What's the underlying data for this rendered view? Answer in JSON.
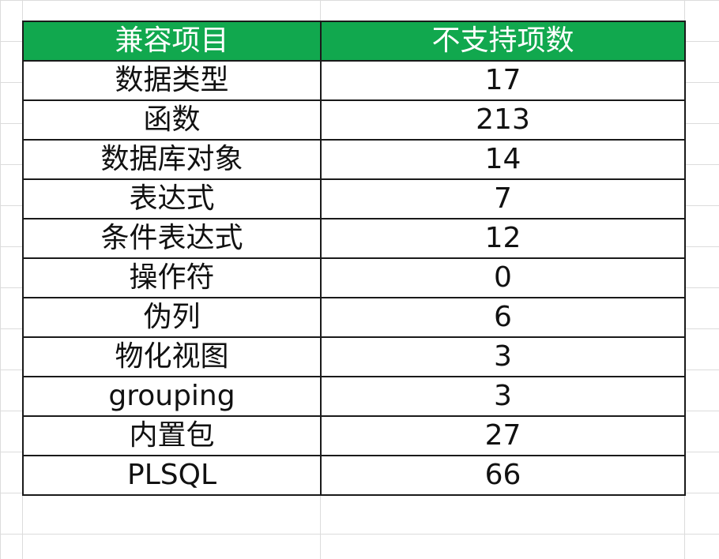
{
  "sheet": {
    "header": {
      "col1": "兼容项目",
      "col2": "不支持项数"
    },
    "rows": [
      {
        "item": "数据类型",
        "count": "17"
      },
      {
        "item": "函数",
        "count": "213"
      },
      {
        "item": "数据库对象",
        "count": "14"
      },
      {
        "item": "表达式",
        "count": "7"
      },
      {
        "item": "条件表达式",
        "count": "12"
      },
      {
        "item": "操作符",
        "count": "0"
      },
      {
        "item": "伪列",
        "count": "6"
      },
      {
        "item": "物化视图",
        "count": "3"
      },
      {
        "item": "grouping",
        "count": "3"
      },
      {
        "item": "内置包",
        "count": "27"
      },
      {
        "item": "PLSQL",
        "count": "66"
      }
    ]
  },
  "colors": {
    "header_bg": "#11a84e",
    "header_text": "#ffffff",
    "border": "#1a1a1a",
    "gridline": "#dcdcdc"
  }
}
